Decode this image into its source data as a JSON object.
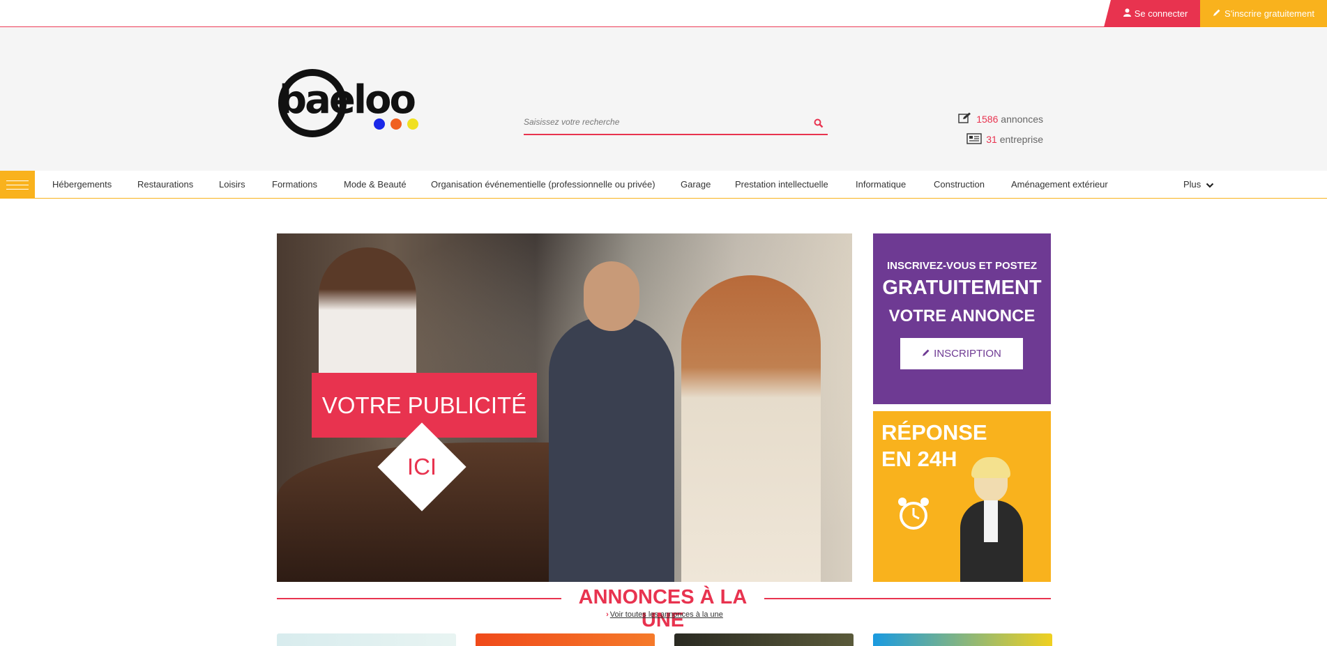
{
  "topbar": {
    "login_label": "Se connecter",
    "signup_label": "S'inscrire gratuitement"
  },
  "header": {
    "logo_text": "baeloo",
    "search_placeholder": "Saisissez votre recherche",
    "stats": [
      {
        "count": "1586",
        "label": "annonces",
        "icon": "edit-icon"
      },
      {
        "count": "31",
        "label": "entreprise",
        "icon": "newspaper-icon"
      }
    ]
  },
  "nav": {
    "items": [
      "Hébergements",
      "Restaurations",
      "Loisirs",
      "Formations",
      "Mode & Beauté",
      "Organisation événementielle (professionnelle ou privée)",
      "Garage",
      "Prestation intellectuelle",
      "Informatique",
      "Construction",
      "Aménagement extérieur"
    ],
    "more_label": "Plus"
  },
  "hero": {
    "pub_label": "VOTRE PUBLICITÉ",
    "ici_label": "ICI"
  },
  "side_purple": {
    "line1": "INSCRIVEZ-VOUS ET POSTEZ",
    "line2": "GRATUITEMENT",
    "line3": "VOTRE ANNONCE",
    "button_label": "INSCRIPTION"
  },
  "side_yellow": {
    "title_line1": "RÉPONSE",
    "title_line2": "EN 24H"
  },
  "section": {
    "title": "ANNONCES À LA UNE",
    "link_label": "Voir toutes les annonces à la une"
  },
  "colors": {
    "accent_red": "#e8334f",
    "accent_yellow": "#f9b21d",
    "purple": "#6e3a93"
  }
}
